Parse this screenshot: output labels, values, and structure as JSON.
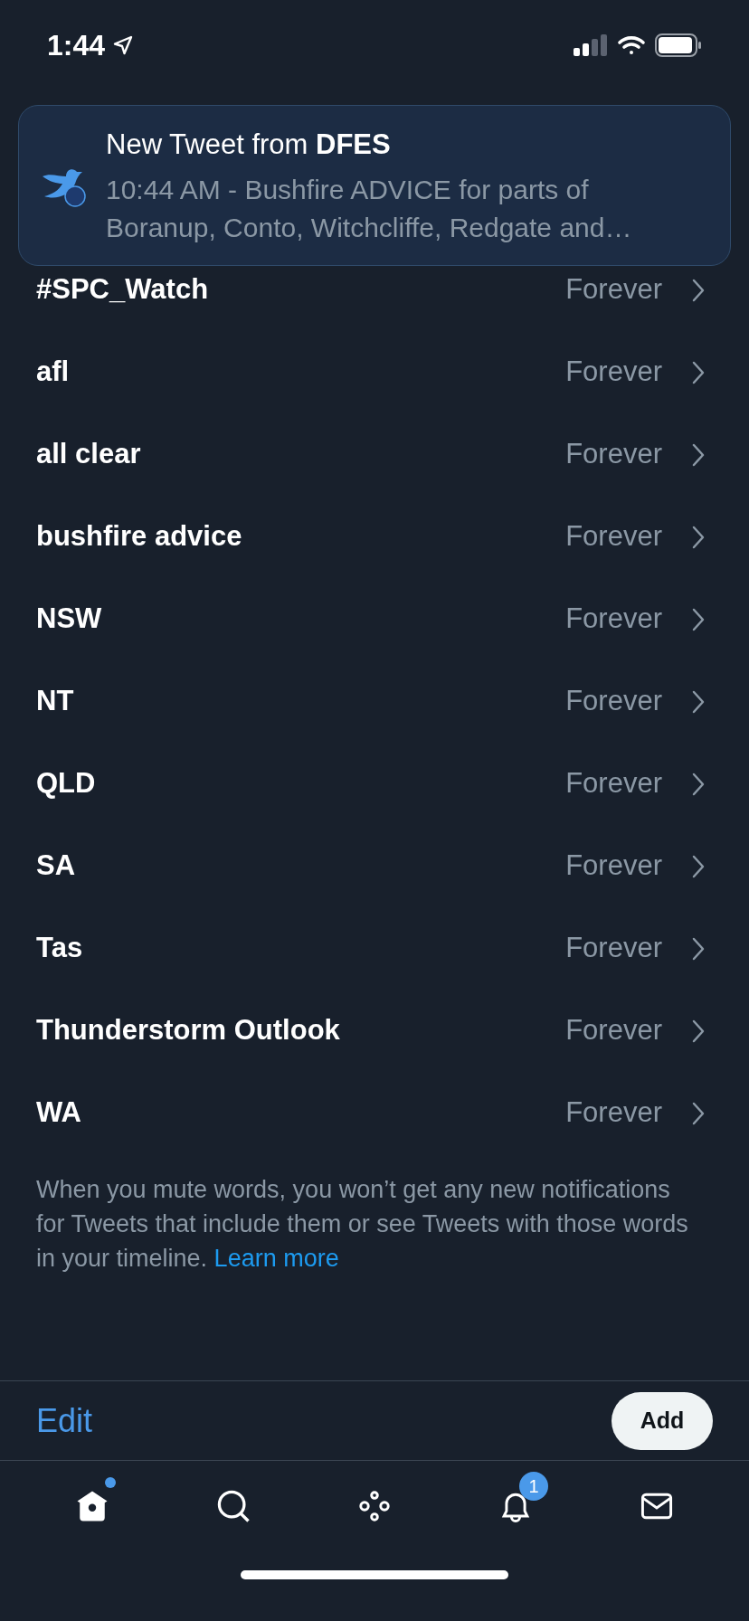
{
  "status_bar": {
    "time": "1:44"
  },
  "notification": {
    "title": "New Tweet from **DFES**",
    "body": "10:44 AM - Bushfire ADVICE for parts of Boranup, Conto, Witchcliffe, Redgate and…"
  },
  "muted_words": [
    {
      "word": "#SPC_Watch",
      "duration": "Forever"
    },
    {
      "word": "afl",
      "duration": "Forever"
    },
    {
      "word": "all clear",
      "duration": "Forever"
    },
    {
      "word": "bushfire advice",
      "duration": "Forever"
    },
    {
      "word": "NSW",
      "duration": "Forever"
    },
    {
      "word": "NT",
      "duration": "Forever"
    },
    {
      "word": "QLD",
      "duration": "Forever"
    },
    {
      "word": "SA",
      "duration": "Forever"
    },
    {
      "word": "Tas",
      "duration": "Forever"
    },
    {
      "word": "Thunderstorm Outlook",
      "duration": "Forever"
    },
    {
      "word": "WA",
      "duration": "Forever"
    }
  ],
  "footer": {
    "text": "When you mute words, you won’t get any new notifications for Tweets that include them or see Tweets with those words in your timeline.",
    "link": "Learn more"
  },
  "toolbar": {
    "edit": "Edit",
    "add": "Add"
  },
  "tab_bar": [
    {
      "kind": "home",
      "selected": true,
      "dot": true
    },
    {
      "kind": "search",
      "selected": false,
      "dot": false
    },
    {
      "kind": "spaces",
      "selected": false,
      "dot": false
    },
    {
      "kind": "notifications",
      "selected": false,
      "dot": false,
      "badge": "1"
    },
    {
      "kind": "messages",
      "selected": false,
      "dot": false
    }
  ]
}
